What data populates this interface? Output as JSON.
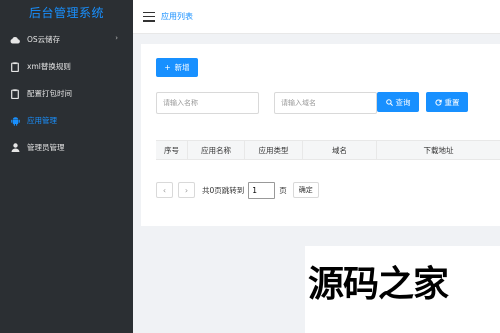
{
  "app": {
    "title": "后台管理系统"
  },
  "sidebar": {
    "items": [
      {
        "label": "OS云储存",
        "icon": "cloud-icon",
        "active": false,
        "has_submenu": true
      },
      {
        "label": "xml替换规则",
        "icon": "clipboard-icon",
        "active": false
      },
      {
        "label": "配置打包时间",
        "icon": "clipboard-icon",
        "active": false
      },
      {
        "label": "应用管理",
        "icon": "android-icon",
        "active": true
      },
      {
        "label": "管理员管理",
        "icon": "user-icon",
        "active": false
      }
    ],
    "submenu_arrow": "›"
  },
  "topbar": {
    "menu_icon": "hamburger-icon",
    "breadcrumb": "应用列表"
  },
  "toolbar": {
    "add_label": "新增",
    "add_icon": "+"
  },
  "search": {
    "name_placeholder": "请输入名称",
    "domain_placeholder": "请输入域名",
    "query_label": "查询",
    "query_icon": "search-icon",
    "reset_label": "重置",
    "reset_icon": "refresh-icon"
  },
  "table": {
    "columns": [
      "序号",
      "应用名称",
      "应用类型",
      "域名",
      "下载地址"
    ],
    "rows": []
  },
  "pagination": {
    "prev": "‹",
    "next": "›",
    "summary": "共0页跳转到",
    "page_value": "1",
    "page_suffix": "页",
    "confirm_label": "确定"
  },
  "watermark": {
    "text": "源码之家"
  },
  "colors": {
    "primary": "#1890ff",
    "sidebar_bg": "#2b2f33",
    "page_bg": "#f0f2f5"
  }
}
